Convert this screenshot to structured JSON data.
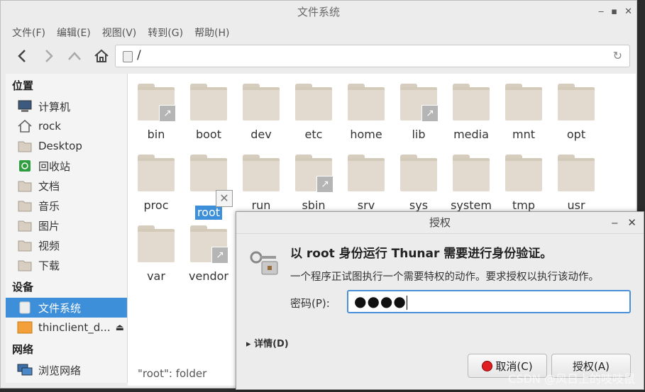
{
  "window": {
    "title": "文件系统"
  },
  "menu": [
    "文件(F)",
    "编辑(E)",
    "视图(V)",
    "转到(G)",
    "帮助(H)"
  ],
  "path": {
    "value": "/"
  },
  "sidebar": {
    "places_heading": "位置",
    "places": [
      {
        "label": "计算机",
        "icon": "computer-icon"
      },
      {
        "label": "rock",
        "icon": "home-icon"
      },
      {
        "label": "Desktop",
        "icon": "desktop-icon"
      },
      {
        "label": "回收站",
        "icon": "trash-icon"
      },
      {
        "label": "文档",
        "icon": "documents-icon"
      },
      {
        "label": "音乐",
        "icon": "music-icon"
      },
      {
        "label": "图片",
        "icon": "pictures-icon"
      },
      {
        "label": "视频",
        "icon": "videos-icon"
      },
      {
        "label": "下载",
        "icon": "downloads-icon"
      }
    ],
    "devices_heading": "设备",
    "devices": [
      {
        "label": "文件系统",
        "icon": "filesystem-icon",
        "active": true
      },
      {
        "label": "thinclient_d...",
        "icon": "drive-icon",
        "eject": "⏏"
      }
    ],
    "network_heading": "网络",
    "network": [
      {
        "label": "浏览网络",
        "icon": "network-icon"
      }
    ]
  },
  "files": [
    {
      "name": "bin",
      "link": true
    },
    {
      "name": "boot"
    },
    {
      "name": "dev"
    },
    {
      "name": "etc"
    },
    {
      "name": "home"
    },
    {
      "name": "lib",
      "link": true
    },
    {
      "name": "media"
    },
    {
      "name": "mnt"
    },
    {
      "name": "opt"
    },
    {
      "name": "proc"
    },
    {
      "name": "root",
      "selected": true,
      "locked": true
    },
    {
      "name": "run"
    },
    {
      "name": "sbin",
      "link": true
    },
    {
      "name": "srv"
    },
    {
      "name": "sys"
    },
    {
      "name": "system"
    },
    {
      "name": "tmp"
    },
    {
      "name": "usr"
    },
    {
      "name": "var"
    },
    {
      "name": "vendor",
      "link": true
    }
  ],
  "status": "\"root\": folder",
  "dialog": {
    "title": "授权",
    "heading": "以 root 身份运行 Thunar 需要进行身份验证。",
    "message": "一个程序正试图执行一个需要特权的动作。要求授权以执行该动作。",
    "password_label": "密码(P):",
    "password_value": "●●●●",
    "details_label": "详情(D)",
    "cancel_label": "取消(C)",
    "auth_label": "授权(A)"
  },
  "watermark": "CSDN @风日上的吱吱鼠"
}
